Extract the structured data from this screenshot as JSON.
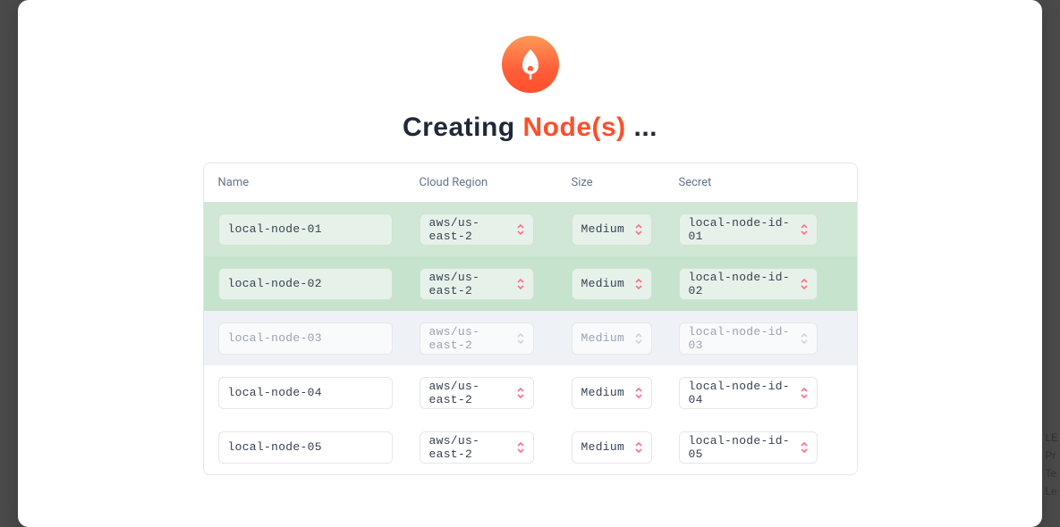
{
  "heading": {
    "prefix": "Creating ",
    "accent": "Node(s)",
    "suffix": " ..."
  },
  "columns": {
    "name": "Name",
    "region": "Cloud Region",
    "size": "Size",
    "secret": "Secret"
  },
  "rows": [
    {
      "state": "done",
      "name": "local-node-01",
      "region": "aws/us-east-2",
      "size": "Medium",
      "secret": "local-node-id-01"
    },
    {
      "state": "done",
      "name": "local-node-02",
      "region": "aws/us-east-2",
      "size": "Medium",
      "secret": "local-node-id-02"
    },
    {
      "state": "processing",
      "name": "local-node-03",
      "region": "aws/us-east-2",
      "size": "Medium",
      "secret": "local-node-id-03"
    },
    {
      "state": "pending",
      "name": "local-node-04",
      "region": "aws/us-east-2",
      "size": "Medium",
      "secret": "local-node-id-04"
    },
    {
      "state": "pending",
      "name": "local-node-05",
      "region": "aws/us-east-2",
      "size": "Medium",
      "secret": "local-node-id-05"
    }
  ],
  "background_hints": [
    "LE",
    "Pr",
    "Te",
    "Le"
  ]
}
